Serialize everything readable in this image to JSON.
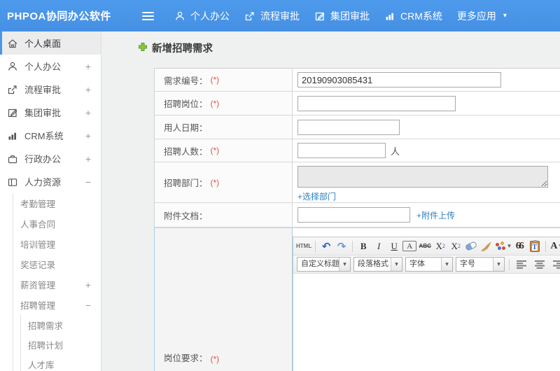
{
  "header": {
    "logo": "PHPOA协同办公软件",
    "nav": [
      {
        "label": "个人办公",
        "icon": "user-icon"
      },
      {
        "label": "流程审批",
        "icon": "workflow-icon"
      },
      {
        "label": "集团审批",
        "icon": "edit-icon"
      },
      {
        "label": "CRM系统",
        "icon": "bar-chart-icon"
      },
      {
        "label": "更多应用",
        "icon": "caret-down-icon"
      }
    ],
    "caret": "▾"
  },
  "sidebar": {
    "items": [
      {
        "label": "个人桌面",
        "icon": "home-icon",
        "active": true
      },
      {
        "label": "个人办公",
        "icon": "user-icon",
        "toggle": "+"
      },
      {
        "label": "流程审批",
        "icon": "workflow-icon",
        "toggle": "+"
      },
      {
        "label": "集团审批",
        "icon": "edit-icon",
        "toggle": "+"
      },
      {
        "label": "CRM系统",
        "icon": "bar-chart-icon",
        "toggle": "+"
      },
      {
        "label": "行政办公",
        "icon": "briefcase-icon",
        "toggle": "+"
      },
      {
        "label": "人力资源",
        "icon": "hr-book-icon",
        "toggle": "−"
      }
    ],
    "hr_children": [
      {
        "label": "考勤管理"
      },
      {
        "label": "人事合同"
      },
      {
        "label": "培训管理"
      },
      {
        "label": "奖惩记录"
      },
      {
        "label": "薪资管理",
        "toggle": "+"
      },
      {
        "label": "招聘管理",
        "toggle": "−"
      }
    ],
    "recruit_children": [
      {
        "label": "招聘需求"
      },
      {
        "label": "招聘计划"
      },
      {
        "label": "人才库"
      }
    ]
  },
  "page": {
    "title": "新增招聘需求"
  },
  "form": {
    "required_mark": "(*)",
    "rows": {
      "demand_no": {
        "label": "需求编号：",
        "value": "20190903085431"
      },
      "position": {
        "label": "招聘岗位：",
        "value": ""
      },
      "hire_date": {
        "label": "用人日期：",
        "value": ""
      },
      "headcount": {
        "label": "招聘人数：",
        "value": "",
        "suffix": "人"
      },
      "department": {
        "label": "招聘部门：",
        "link": "+选择部门"
      },
      "attachment": {
        "label": "附件文档：",
        "link": "+附件上传"
      },
      "requirements": {
        "label": "岗位要求："
      }
    }
  },
  "editor": {
    "html_button": "HTML",
    "glyphs": {
      "undo": "↶",
      "redo": "↷",
      "bold": "B",
      "italic": "I",
      "underline": "U",
      "font_box": "A",
      "strike": "ABC",
      "sup_base": "X",
      "sup": "2",
      "sub_base": "X",
      "sub": "2",
      "quote": "66",
      "paste_t": "T",
      "font_color": "A",
      "highlight": "a",
      "caret": "▾"
    },
    "dropdowns": {
      "heading": "自定义标题",
      "paragraph": "段落格式",
      "font_family": "字体",
      "font_size": "字号"
    }
  },
  "colors": {
    "header_blue": "#4a96e9",
    "link_blue": "#2e7fc1",
    "required_red": "#e0524c",
    "plus_green": "#8dc63f"
  }
}
